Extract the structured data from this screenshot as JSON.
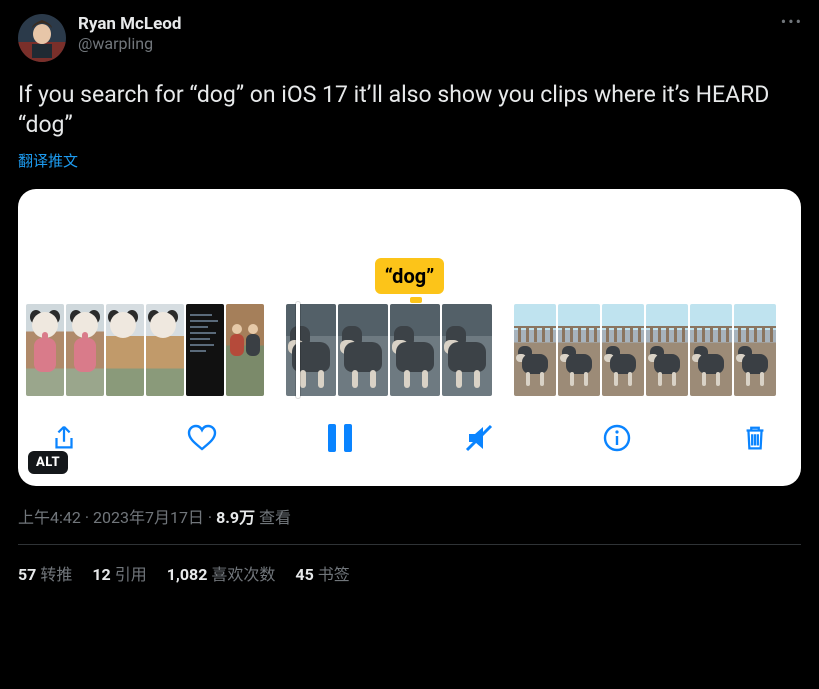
{
  "user": {
    "display_name": "Ryan McLeod",
    "handle": "@warpling"
  },
  "tweet": {
    "text": "If you search for “dog” on iOS 17 it’ll also show you clips where it’s HEARD “dog”",
    "translate_label": "翻译推文",
    "media": {
      "search_chip": "“dog”",
      "alt_badge": "ALT"
    }
  },
  "meta": {
    "time": "上午4:42",
    "date": "2023年7月17日",
    "sep": " · ",
    "views_number": "8.9万",
    "views_label": " 查看"
  },
  "stats": {
    "retweets_n": "57",
    "retweets_l": "转推",
    "quotes_n": "12",
    "quotes_l": "引用",
    "likes_n": "1,082",
    "likes_l": "喜欢次数",
    "bookmarks_n": "45",
    "bookmarks_l": "书签"
  }
}
